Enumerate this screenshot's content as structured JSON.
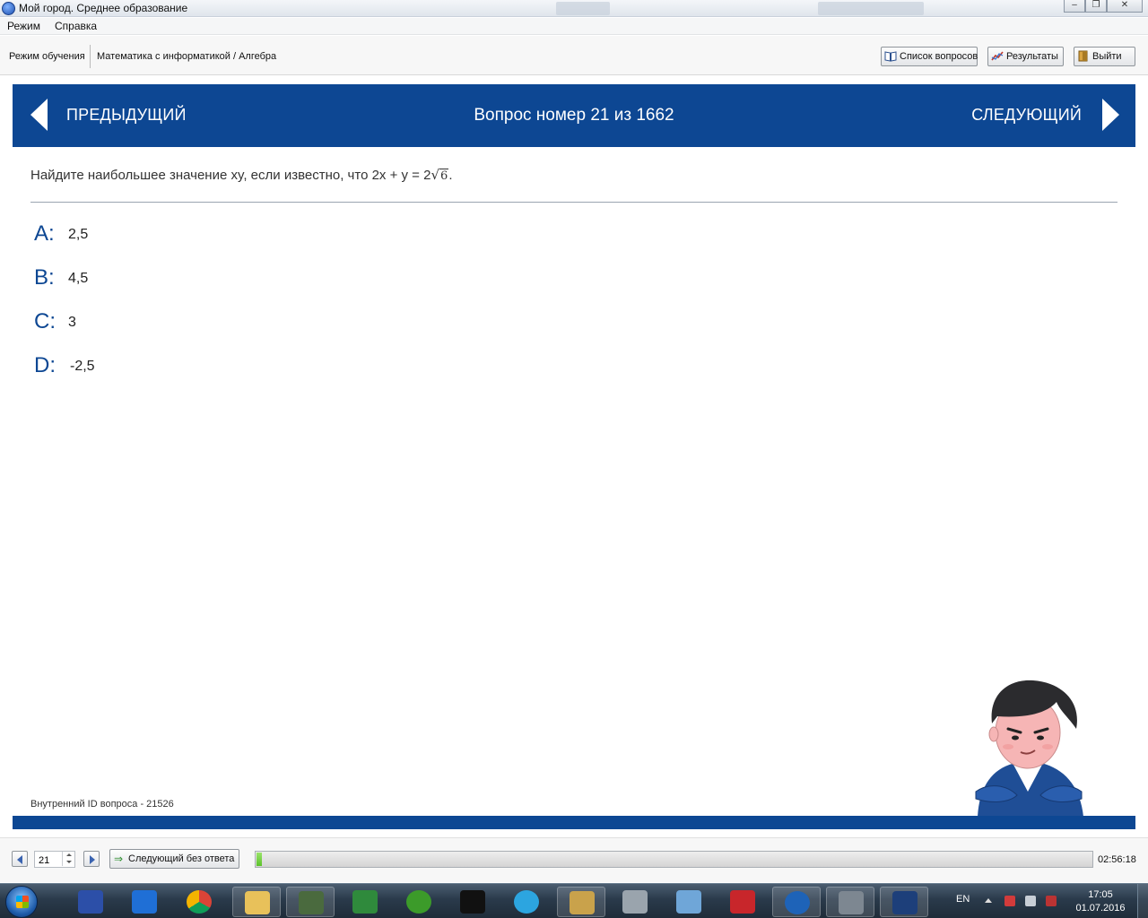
{
  "window": {
    "title": "Мой город. Среднее образование",
    "controls": [
      "minimize-icon",
      "maximize-icon",
      "close-icon"
    ]
  },
  "menu": {
    "items": [
      "Режим",
      "Справка"
    ]
  },
  "toolbar": {
    "breadcrumb_mode": "Режим обучения",
    "breadcrumb_subject": "Математика с информатикой / Алгебра",
    "list_button": "Список вопросов",
    "results_button": "Результаты",
    "exit_button": "Выйти"
  },
  "header": {
    "prev_label": "ПРЕДЫДУЩИЙ",
    "question_counter": "Вопрос номер 21 из 1662",
    "next_label": "СЛЕДУЮЩИЙ",
    "color": "#0d4793"
  },
  "question": {
    "text_before": "Найдите наибольшее значение xy, если известно, что 2x + y = 2",
    "radicand": "6",
    "text_after": ".",
    "answers": [
      {
        "letter": "A:",
        "value": "2,5"
      },
      {
        "letter": "B:",
        "value": "4,5"
      },
      {
        "letter": "C:",
        "value": "3"
      },
      {
        "letter": "D:",
        "value": "-2,5"
      }
    ],
    "internal_id": "Внутренний ID вопроса - 21526"
  },
  "footer": {
    "page_value": "21",
    "skip_button": "Следующий без ответа",
    "progress_fraction": 0.006,
    "timer": "02:56:18"
  },
  "taskbar": {
    "apps": [
      "save-icon",
      "d-app-icon",
      "chrome-icon",
      "folder-icon",
      "monitor-icon",
      "download-globe-icon",
      "utorrent-icon",
      "cmd-icon",
      "telegram-icon",
      "winamp-icon",
      "camera-icon",
      "paint-icon",
      "book-icon",
      "top-app-icon",
      "calculator-icon",
      "graduation-cap-icon"
    ],
    "language": "EN",
    "time": "17:05",
    "date": "01.07.2016"
  }
}
